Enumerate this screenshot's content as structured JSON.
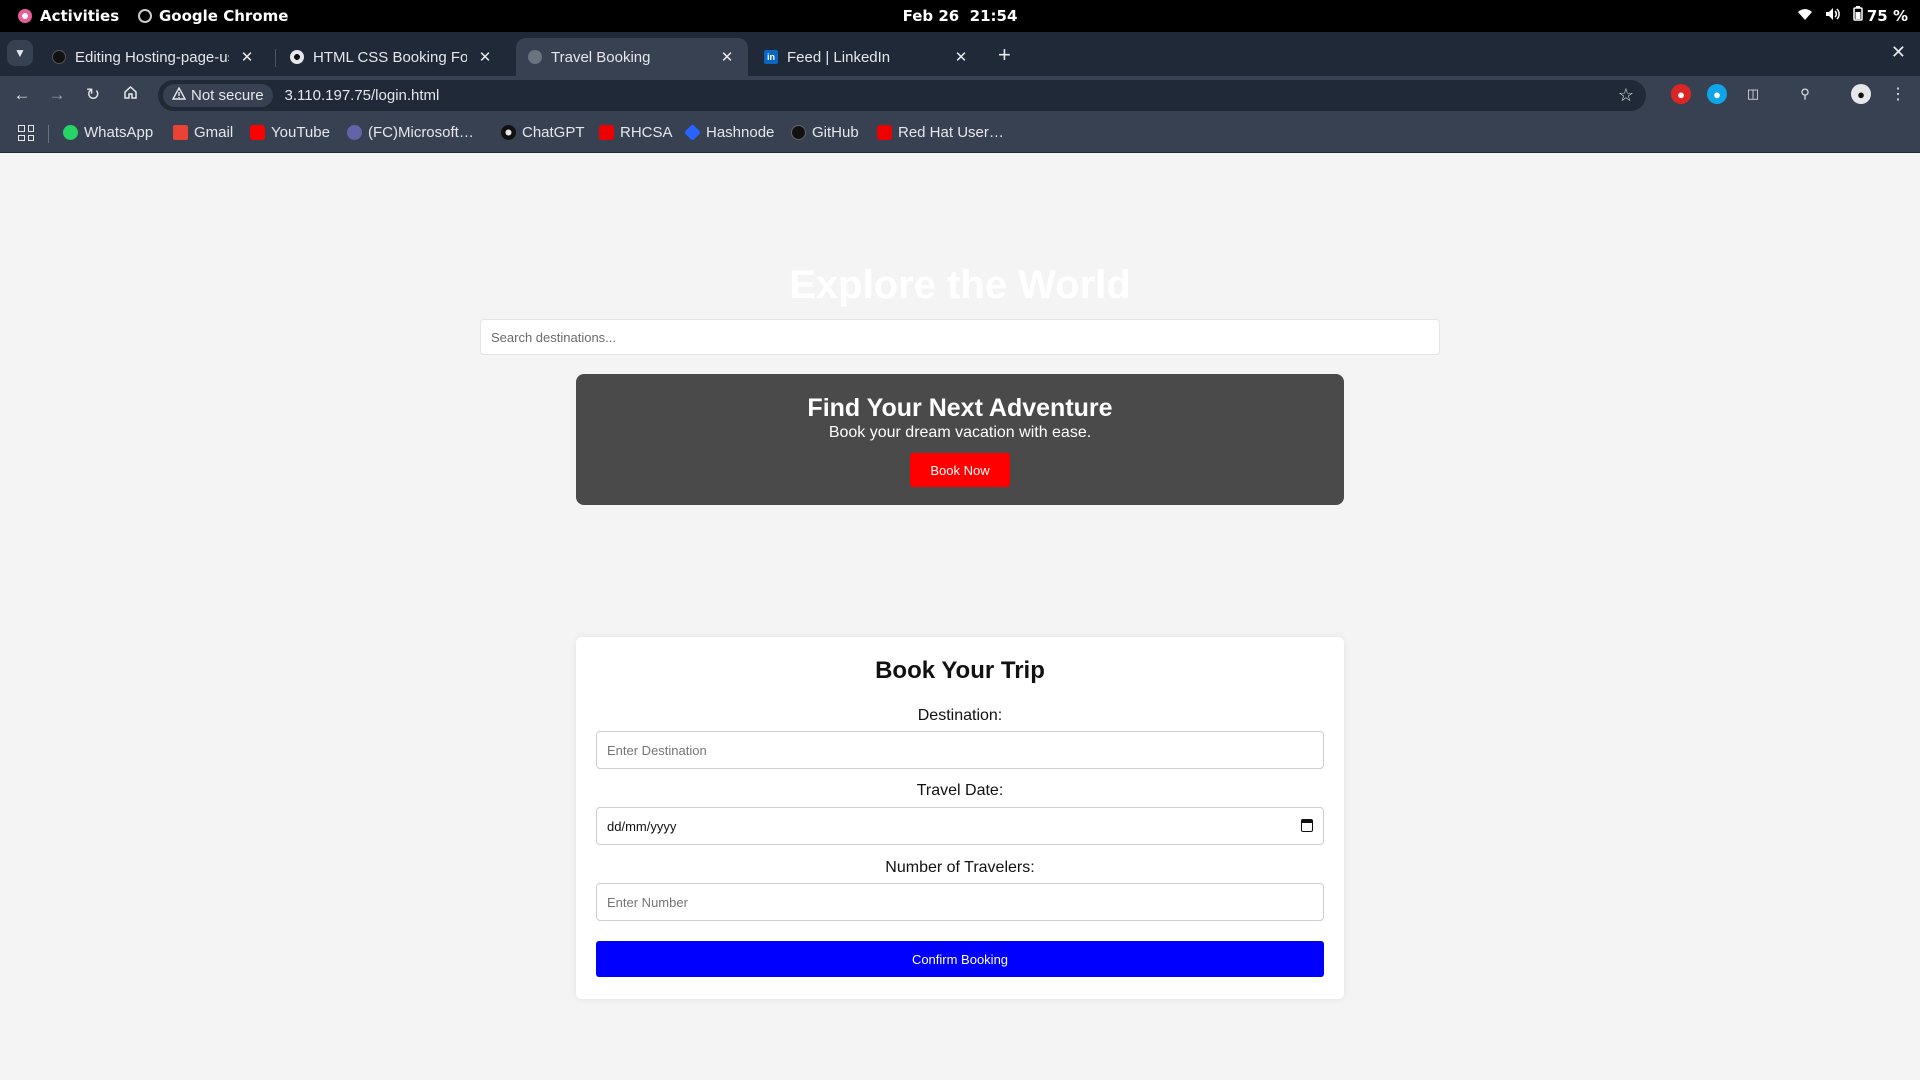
{
  "system_bar": {
    "activities_label": "Activities",
    "app_name": "Google Chrome",
    "date": "Feb 26",
    "time": "21:54",
    "battery": "75 %"
  },
  "browser": {
    "tabs": [
      {
        "title": "Editing Hosting-page-us",
        "icon": "github-icon",
        "active": false
      },
      {
        "title": "HTML CSS Booking Form",
        "icon": "chatgpt-icon",
        "active": false
      },
      {
        "title": "Travel Booking",
        "icon": "globe-icon",
        "active": true
      },
      {
        "title": "Feed | LinkedIn",
        "icon": "linkedin-icon",
        "active": false
      }
    ],
    "security_chip": "Not secure",
    "url": "3.110.197.75/login.html",
    "bookmarks": [
      {
        "label": "WhatsApp",
        "color": "#25d366"
      },
      {
        "label": "Gmail",
        "color": "#ea4335"
      },
      {
        "label": "YouTube",
        "color": "#ff0000"
      },
      {
        "label": "(FC)Microsoft…",
        "color": "#6264a7"
      },
      {
        "label": "ChatGPT",
        "color": "#e5e7eb"
      },
      {
        "label": "RHCSA",
        "color": "#ee0000"
      },
      {
        "label": "Hashnode",
        "color": "#2962ff"
      },
      {
        "label": "GitHub",
        "color": "#111111"
      },
      {
        "label": "Red Hat User…",
        "color": "#ee0000"
      }
    ]
  },
  "page": {
    "hero_title": "Explore the World",
    "search_placeholder": "Search destinations...",
    "banner": {
      "heading": "Find Your Next Adventure",
      "subtext": "Book your dream vacation with ease.",
      "button_label": "Book Now"
    },
    "booking_form": {
      "title": "Book Your Trip",
      "destination_label": "Destination:",
      "destination_placeholder": "Enter Destination",
      "date_label": "Travel Date:",
      "date_placeholder": "dd/mm/yyyy",
      "travelers_label": "Number of Travelers:",
      "travelers_placeholder": "Enter Number",
      "submit_label": "Confirm Booking"
    }
  },
  "colors": {
    "banner_bg": "#4a4a4a",
    "book_now_button": "#ff0000",
    "confirm_button": "#0000ff",
    "page_bg": "#f4f4f4"
  }
}
